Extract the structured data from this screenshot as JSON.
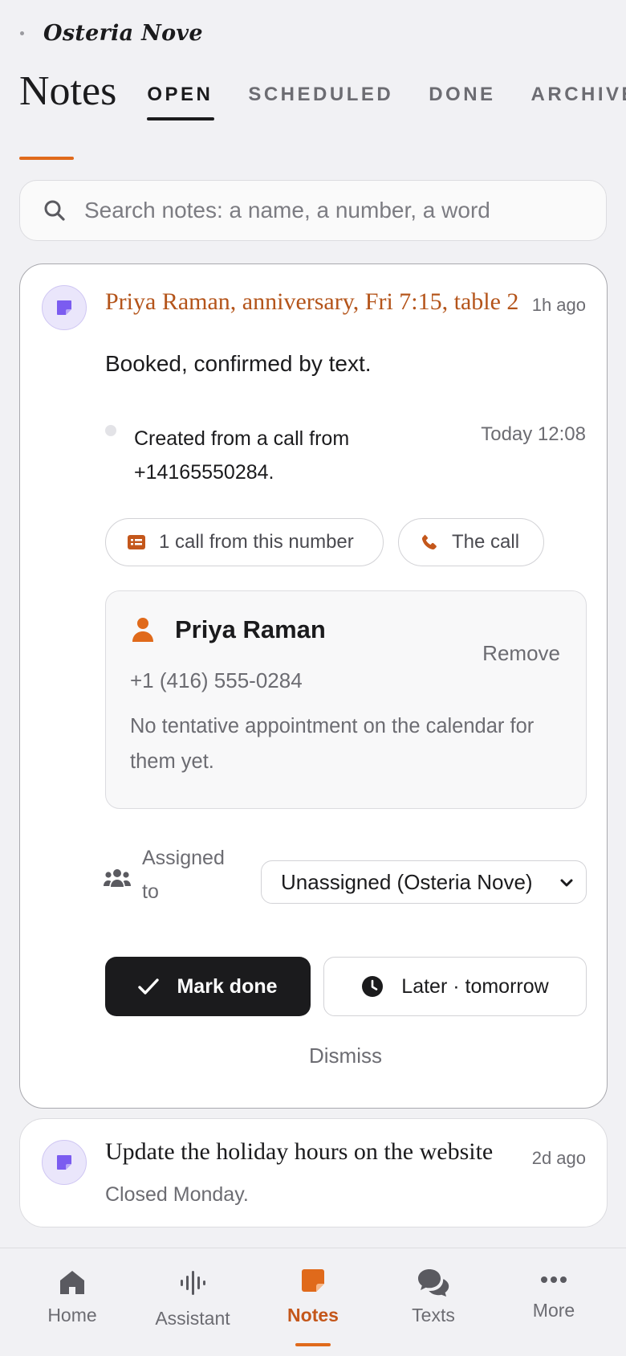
{
  "header": {
    "brand": "Osteria Nove",
    "title": "Notes",
    "tabs": [
      {
        "label": "OPEN",
        "active": true
      },
      {
        "label": "SCHEDULED",
        "active": false
      },
      {
        "label": "DONE",
        "active": false
      },
      {
        "label": "ARCHIVED",
        "active": false
      }
    ]
  },
  "search": {
    "placeholder": "Search notes: a name, a number, a word",
    "value": ""
  },
  "notes": [
    {
      "title": "Priya Raman, anniversary, Fri 7:15, table 2",
      "time": "1h ago",
      "body": "Booked, confirmed by text.",
      "timeline": {
        "text": "Created from a call from +14165550284.",
        "time": "Today 12:08"
      },
      "chips": {
        "calls": "1 call from this number",
        "call": "The call"
      },
      "contact": {
        "name": "Priya Raman",
        "phone": "+1 (416) 555-0284",
        "remove": "Remove",
        "note": "No tentative appointment on the calendar for them yet."
      },
      "assigned": {
        "label": "Assigned to",
        "value": "Unassigned (Osteria Nove)"
      },
      "actions": {
        "done": "Mark done",
        "later": "Later · tomorrow",
        "dismiss": "Dismiss"
      }
    },
    {
      "title": "Update the holiday hours on the website",
      "time": "2d ago",
      "subtitle": "Closed Monday."
    }
  ],
  "nav": {
    "items": [
      {
        "label": "Home",
        "icon": "home-icon"
      },
      {
        "label": "Assistant",
        "icon": "waveform-icon"
      },
      {
        "label": "Notes",
        "icon": "note-icon",
        "active": true
      },
      {
        "label": "Texts",
        "icon": "chat-bubbles-icon"
      },
      {
        "label": "More",
        "icon": "more-dots-icon"
      }
    ]
  },
  "colors": {
    "accent": "#e06a1b",
    "note_title": "#b4541a",
    "badge": "#7b5cf0",
    "dark_button": "#1b1b1d"
  }
}
